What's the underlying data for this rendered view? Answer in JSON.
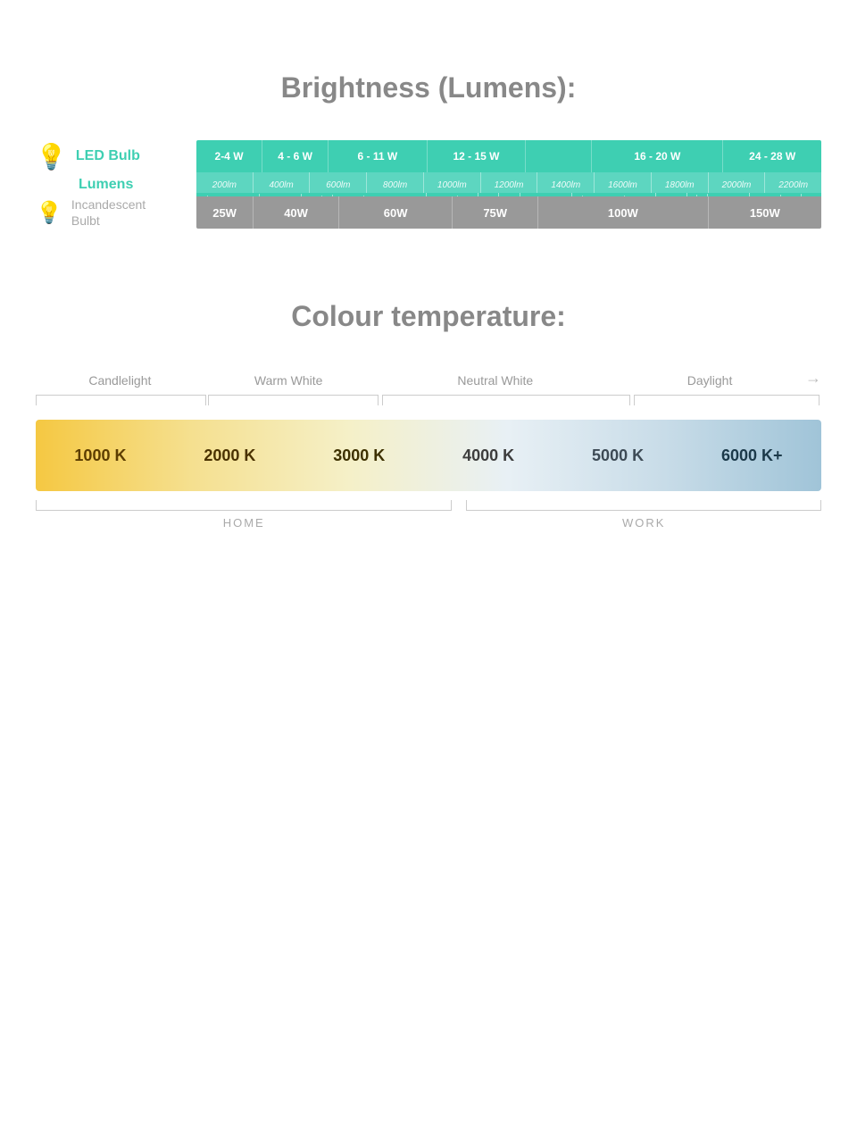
{
  "brightness": {
    "title": "Brightness (Lumens):",
    "led_label": "LED Bulb",
    "lumens_label": "Lumens",
    "incandescent_label": "Incandescent\nBulbt",
    "wattage_segments": [
      {
        "label": "2-4 W",
        "flex": 1
      },
      {
        "label": "4 - 6 W",
        "flex": 1
      },
      {
        "label": "6 - 11 W",
        "flex": 1.5
      },
      {
        "label": "12 - 15 W",
        "flex": 1.5
      },
      {
        "label": "",
        "flex": 1
      },
      {
        "label": "16 - 20 W",
        "flex": 2
      },
      {
        "label": "24 - 28 W",
        "flex": 1.5
      }
    ],
    "lumen_values": [
      "200lm",
      "400lm",
      "600lm",
      "800lm",
      "1000lm",
      "1200lm",
      "1400lm",
      "1600lm",
      "1800lm",
      "2000lm",
      "2200lm"
    ],
    "incandescent_segments": [
      {
        "label": "25W",
        "flex": 1
      },
      {
        "label": "40W",
        "flex": 1.2
      },
      {
        "label": "",
        "flex": 0.5
      },
      {
        "label": "60W",
        "flex": 1.5
      },
      {
        "label": "75W",
        "flex": 1
      },
      {
        "label": "",
        "flex": 1
      },
      {
        "label": "100W",
        "flex": 2
      },
      {
        "label": "",
        "flex": 1
      },
      {
        "label": "150W",
        "flex": 1.5
      }
    ]
  },
  "colour_temperature": {
    "title": "Colour temperature:",
    "categories": [
      {
        "label": "Candlelight",
        "width_pct": 22
      },
      {
        "label": "Warm White",
        "width_pct": 22
      },
      {
        "label": "Neutral White",
        "width_pct": 32
      },
      {
        "label": "Daylight",
        "width_pct": 24
      }
    ],
    "kelvin_labels": [
      {
        "value": "1000 K",
        "color": "#6b4a00"
      },
      {
        "value": "2000 K",
        "color": "#5a4200"
      },
      {
        "value": "3000 K",
        "color": "#4a3800"
      },
      {
        "value": "4000 K",
        "color": "#3d3d3d"
      },
      {
        "value": "5000 K",
        "color": "#3d4a55"
      },
      {
        "value": "6000 K+",
        "color": "#2c4a5a"
      }
    ],
    "home_label": "HOME",
    "work_label": "WORK",
    "home_width_pct": 53,
    "work_width_pct": 45
  }
}
